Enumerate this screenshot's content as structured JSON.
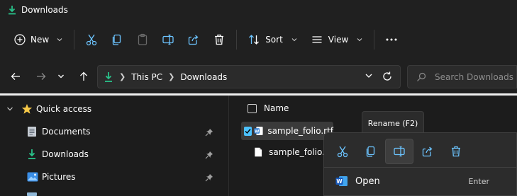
{
  "window": {
    "title": "Downloads"
  },
  "commandbar": {
    "new_label": "New",
    "sort_label": "Sort",
    "view_label": "View"
  },
  "address": {
    "crumbs": [
      "This PC",
      "Downloads"
    ],
    "search_placeholder": "Search Downloads"
  },
  "navpane": {
    "quick_access": "Quick access",
    "items": [
      {
        "label": "Documents",
        "icon": "documents-icon"
      },
      {
        "label": "Downloads",
        "icon": "downloads-icon"
      },
      {
        "label": "Pictures",
        "icon": "pictures-icon"
      }
    ]
  },
  "content": {
    "column_name": "Name",
    "files": [
      {
        "name": "sample_folio.rtf",
        "selected": true
      },
      {
        "name": "sample_folio.xr",
        "selected": false
      }
    ]
  },
  "tooltip": {
    "text": "Rename (F2)"
  },
  "context_menu": {
    "open_label": "Open",
    "open_shortcut": "Enter"
  },
  "colors": {
    "accent": "#4cc2ff",
    "download_green": "#29c28a",
    "folder_yellow": "#f7c948",
    "word_blue": "#2b7cd3"
  }
}
